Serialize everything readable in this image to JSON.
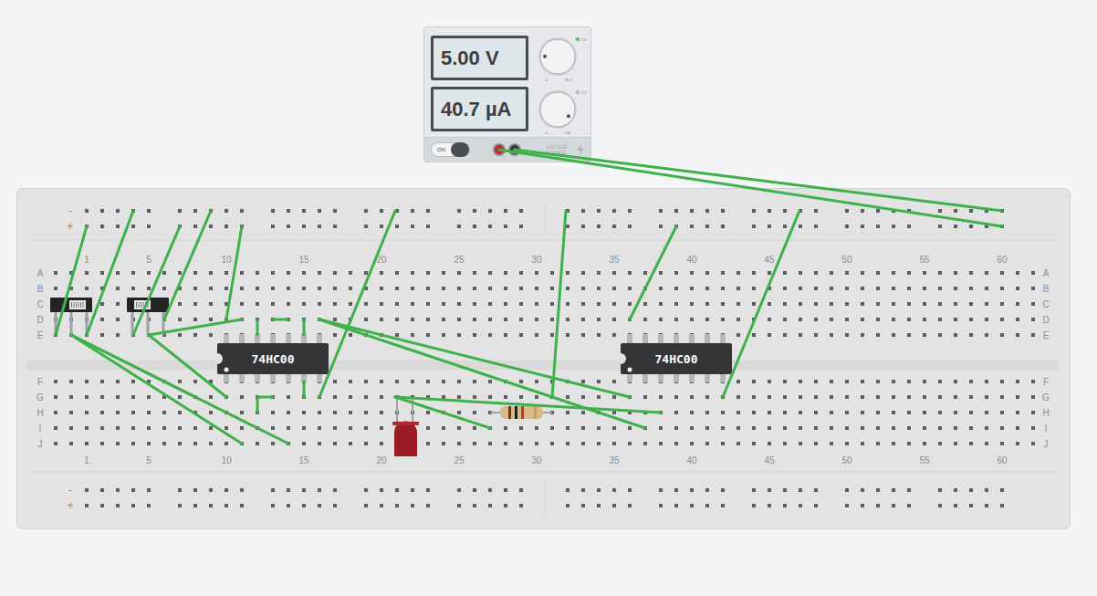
{
  "power_supply": {
    "voltage": "5.00 V",
    "current": "40.7 µA",
    "power_label": "ON",
    "on": true,
    "modes": [
      {
        "label": "CV",
        "active": true
      },
      {
        "label": "CC",
        "active": false
      }
    ],
    "voltage_knob": {
      "min": "0",
      "max": "30 V",
      "level": 0.17
    },
    "current_knob": {
      "min": "0",
      "max": "5 A",
      "level": 0.95
    },
    "brand": "VOLTAGE SOURCE"
  },
  "breadboard": {
    "rail_minus": "-",
    "rail_plus": "+",
    "row_labels": [
      "A",
      "B",
      "C",
      "D",
      "E",
      "F",
      "G",
      "H",
      "I",
      "J"
    ],
    "column_labels": [
      "1",
      "5",
      "10",
      "15",
      "20",
      "25",
      "30",
      "35",
      "40",
      "45",
      "50",
      "55",
      "60"
    ]
  },
  "chips": [
    {
      "label": "74HC00"
    },
    {
      "label": "74HC00"
    }
  ],
  "switches": [
    {
      "on": true
    },
    {
      "on": false
    }
  ],
  "led": {
    "lit": false
  }
}
